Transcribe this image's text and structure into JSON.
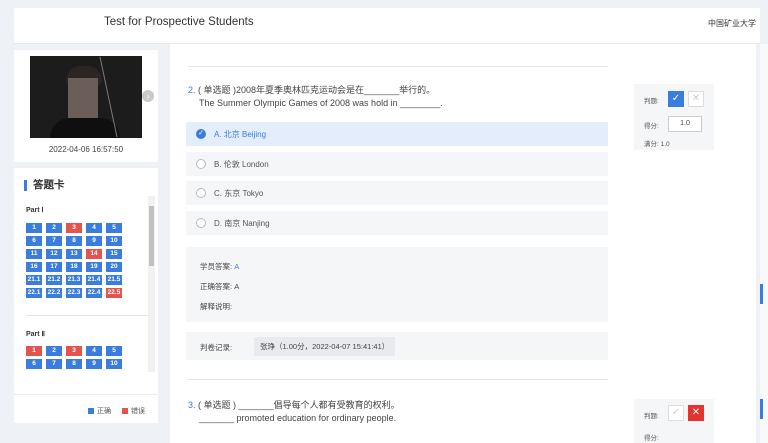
{
  "header": {
    "title": "Test for Prospective Students",
    "org": "中国矿业大学"
  },
  "video": {
    "timestamp": "2022-04-06 16:57:50",
    "next_icon": "chevron-right-icon"
  },
  "answer_card": {
    "title": "答题卡",
    "parts": [
      {
        "label": "Part Ⅰ",
        "cells": [
          {
            "n": "1",
            "s": "correct"
          },
          {
            "n": "2",
            "s": "correct"
          },
          {
            "n": "3",
            "s": "wrong"
          },
          {
            "n": "4",
            "s": "correct"
          },
          {
            "n": "5",
            "s": "correct"
          },
          {
            "n": "6",
            "s": "correct"
          },
          {
            "n": "7",
            "s": "correct"
          },
          {
            "n": "8",
            "s": "correct"
          },
          {
            "n": "9",
            "s": "correct"
          },
          {
            "n": "10",
            "s": "correct"
          },
          {
            "n": "11",
            "s": "correct"
          },
          {
            "n": "12",
            "s": "correct"
          },
          {
            "n": "13",
            "s": "correct"
          },
          {
            "n": "14",
            "s": "wrong"
          },
          {
            "n": "15",
            "s": "correct"
          },
          {
            "n": "16",
            "s": "correct"
          },
          {
            "n": "17",
            "s": "correct"
          },
          {
            "n": "18",
            "s": "correct"
          },
          {
            "n": "19",
            "s": "correct"
          },
          {
            "n": "20",
            "s": "correct"
          },
          {
            "n": "21.1",
            "s": "correct"
          },
          {
            "n": "21.2",
            "s": "correct"
          },
          {
            "n": "21.3",
            "s": "correct"
          },
          {
            "n": "21.4",
            "s": "correct"
          },
          {
            "n": "21.5",
            "s": "correct"
          },
          {
            "n": "22.1",
            "s": "correct"
          },
          {
            "n": "22.2",
            "s": "correct"
          },
          {
            "n": "22.3",
            "s": "correct"
          },
          {
            "n": "22.4",
            "s": "correct"
          },
          {
            "n": "22.5",
            "s": "wrong"
          }
        ]
      },
      {
        "label": "Part Ⅱ",
        "cells": [
          {
            "n": "1",
            "s": "wrong"
          },
          {
            "n": "2",
            "s": "correct"
          },
          {
            "n": "3",
            "s": "wrong"
          },
          {
            "n": "4",
            "s": "correct"
          },
          {
            "n": "5",
            "s": "correct"
          },
          {
            "n": "6",
            "s": "correct"
          },
          {
            "n": "7",
            "s": "correct"
          },
          {
            "n": "8",
            "s": "correct"
          },
          {
            "n": "9",
            "s": "correct"
          },
          {
            "n": "10",
            "s": "correct"
          }
        ]
      }
    ],
    "legend": {
      "correct": "正确",
      "wrong": "错误"
    },
    "colors": {
      "correct": "#3b7ddd",
      "wrong": "#e4544f"
    }
  },
  "question2": {
    "number": "2.",
    "type": "( 单选题 )",
    "text_cn": "2008年夏季奥林匹克运动会是在_______举行的。",
    "text_en": "The Summer Olympic Games of 2008 was hold in ________.",
    "options": [
      {
        "label": "A.  北京 Beijing",
        "selected": true
      },
      {
        "label": "B.  伦敦 London",
        "selected": false
      },
      {
        "label": "C.  东京 Tokyo",
        "selected": false
      },
      {
        "label": "D.  南京 Nanjing",
        "selected": false
      }
    ],
    "student_answer_label": "学员答案:",
    "student_answer": "A",
    "correct_answer_label": "正确答案:",
    "correct_answer": "A",
    "explanation_label": "解释说明:",
    "record_label": "判卷记录:",
    "record_value": "张琤（1.00分，2022-04-07 15:41:41）",
    "judge": {
      "label": "判题:",
      "score_label": "得分:",
      "score_value": "1.0",
      "full_label": "满分:",
      "full_value": "1.0"
    }
  },
  "question3": {
    "number": "3.",
    "type": "( 单选题 )",
    "text_cn": "_______倡导每个人都有受教育的权利。",
    "text_en": "_______ promoted education for ordinary people.",
    "judge": {
      "label": "判题:",
      "score_label": "得分:"
    }
  }
}
